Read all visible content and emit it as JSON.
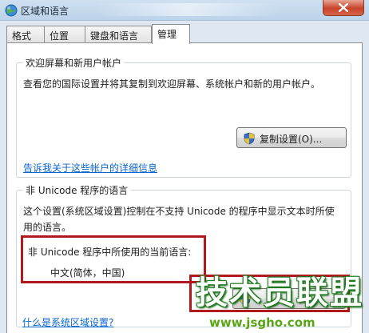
{
  "window": {
    "title": "区域和语言",
    "title_icon": "globe-icon",
    "close_icon": "close-icon"
  },
  "tabs": [
    {
      "label": "格式",
      "active": false
    },
    {
      "label": "位置",
      "active": false
    },
    {
      "label": "键盘和语言",
      "active": false
    },
    {
      "label": "管理",
      "active": true
    }
  ],
  "welcome_group": {
    "legend": "欢迎屏幕和新用户帐户",
    "description": "查看您的国际设置并将其复制到欢迎屏幕、系统帐户和新的用户帐户。",
    "copy_button_label": "复制设置(O)...",
    "copy_button_icon": "shield-icon",
    "details_link": "告诉我关于这些帐户的详细信息"
  },
  "unicode_group": {
    "legend": "非 Unicode 程序的语言",
    "description_line1": "这个设置(系统区域设置)控制在不支持 Unicode 的程序中显示文本时所使",
    "description_line2": "用的语言。",
    "current_label": "非 Unicode 程序中所使用的当前语言:",
    "current_value": "中文(简体，中国)",
    "change_button_icon": "shield-icon",
    "help_link": "什么是系统区域设置?"
  },
  "watermark": {
    "text": "技术员联盟",
    "url": "www.jsgho.com"
  },
  "colors": {
    "highlight_box": "#b2191e",
    "link": "#0a66cc"
  }
}
